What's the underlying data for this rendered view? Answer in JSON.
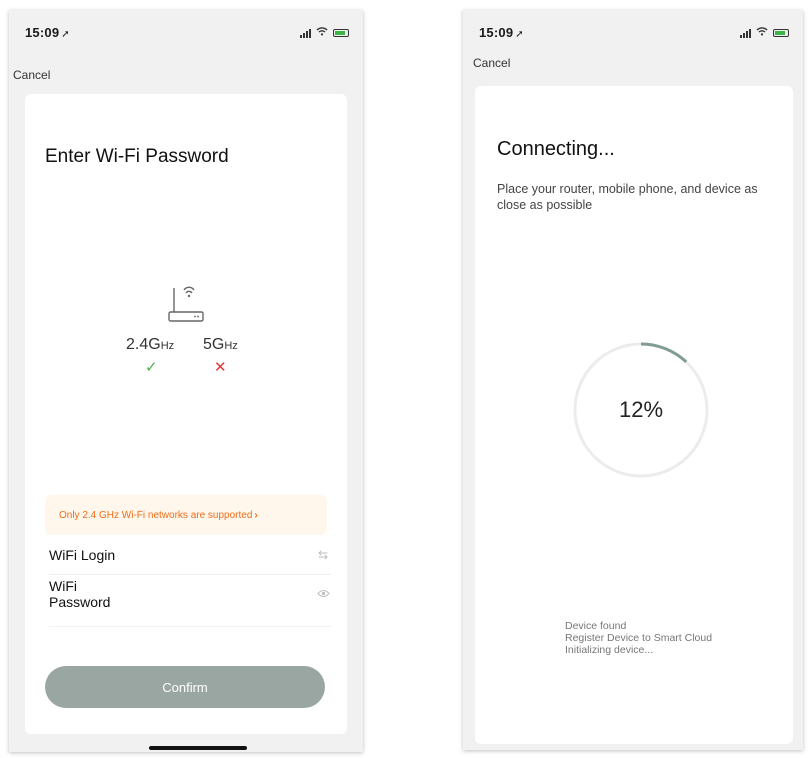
{
  "left_screen": {
    "status": {
      "time": "15:09",
      "location_icon": "location-arrow-icon"
    },
    "cancel_label": "Cancel",
    "title": "Enter Wi-Fi Password",
    "router": {
      "icon": "router-wifi-icon",
      "band_24_main": "2.4G",
      "band_24_unit": "Hz",
      "band_5_main": "5G",
      "band_5_unit": "Hz",
      "band_24_status": "✓",
      "band_5_status": "✕"
    },
    "notice": {
      "text": "Only 2.4 GHz Wi-Fi networks are supported",
      "chevron": "›"
    },
    "wifi_login": {
      "label": "WiFi Login",
      "value": "",
      "placeholder": ""
    },
    "wifi_password": {
      "label": "WiFi Password",
      "value": "",
      "placeholder": ""
    },
    "confirm_label": "Confirm"
  },
  "right_screen": {
    "status": {
      "time": "15:09",
      "location_icon": "location-arrow-icon"
    },
    "cancel_label": "Cancel",
    "title": "Connecting...",
    "subtitle": "Place your router, mobile phone, and device as close as possible",
    "progress": {
      "value": 12,
      "label": "12%"
    },
    "steps": [
      "Device found",
      "Register Device to Smart Cloud",
      "Initializing device..."
    ]
  },
  "colors": {
    "accent_green": "#4caf50",
    "error_red": "#e53935",
    "notice_orange": "#ef6c1a",
    "notice_bg": "#fff7ec",
    "button_gray": "#9aa6a2",
    "progress_arc": "#7f9c95",
    "progress_track": "#ececec"
  }
}
